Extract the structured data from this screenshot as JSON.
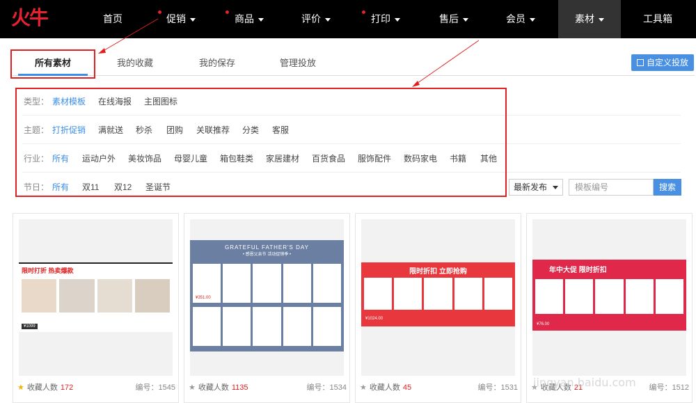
{
  "logo": {
    "text": "火牛"
  },
  "nav": {
    "items": [
      {
        "label": "首页"
      },
      {
        "label": "促销"
      },
      {
        "label": "商品"
      },
      {
        "label": "评价"
      },
      {
        "label": "打印"
      },
      {
        "label": "售后"
      },
      {
        "label": "会员"
      },
      {
        "label": "素材"
      },
      {
        "label": "工具箱"
      }
    ]
  },
  "tabs": [
    {
      "label": "所有素材"
    },
    {
      "label": "我的收藏"
    },
    {
      "label": "我的保存"
    },
    {
      "label": "管理投放"
    }
  ],
  "custom_button": "自定义投放",
  "filters": {
    "type": {
      "label": "类型：",
      "options": [
        "素材模板",
        "在线海报",
        "主图图标"
      ]
    },
    "theme": {
      "label": "主题：",
      "options": [
        "打折促销",
        "满就送",
        "秒杀",
        "团购",
        "关联推荐",
        "分类",
        "客服"
      ]
    },
    "industry": {
      "label": "行业：",
      "options": [
        "所有",
        "运动户外",
        "美妆饰品",
        "母婴儿童",
        "箱包鞋类",
        "家居建材",
        "百货食品",
        "服饰配件",
        "数码家电",
        "书籍",
        "其他"
      ]
    },
    "festival": {
      "label": "节日：",
      "options": [
        "所有",
        "双11",
        "双12",
        "圣诞节"
      ]
    }
  },
  "sort": {
    "value": "最新发布"
  },
  "search": {
    "placeholder": "模板编号",
    "button": "搜索"
  },
  "cards": [
    {
      "fav_label": "收藏人数",
      "fav_count": "172",
      "code": "编号：1545",
      "banner_title": "限时打折  热卖爆款",
      "price": "¥1099"
    },
    {
      "fav_label": "收藏人数",
      "fav_count": "1135",
      "code": "编号：1534",
      "banner_title": "GRATEFUL FATHER'S DAY",
      "banner_sub": "• 感恩父亲节 活动促销季 •",
      "price": "¥351.00"
    },
    {
      "fav_label": "收藏人数",
      "fav_count": "45",
      "code": "编号：1531",
      "banner_title": "限时折扣  立即抢购",
      "price": "¥1024.00"
    },
    {
      "fav_label": "收藏人数",
      "fav_count": "21",
      "code": "编号：1512",
      "banner_title": "年中大促  限时折扣",
      "price": "¥76.00"
    }
  ],
  "watermark": "jingyan.baidu.com"
}
